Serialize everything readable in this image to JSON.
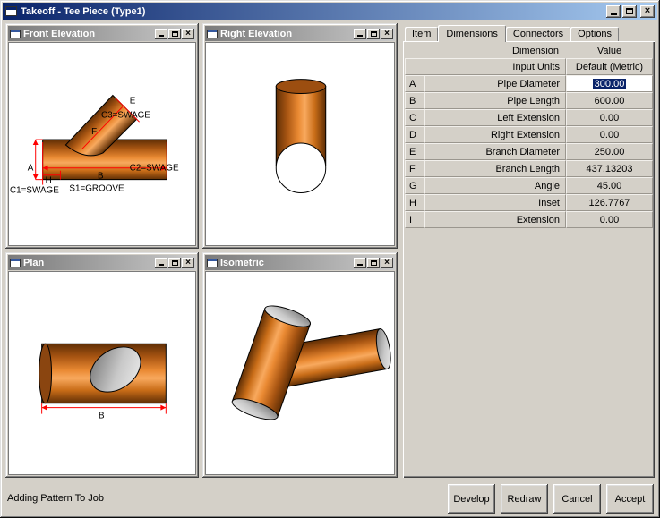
{
  "window": {
    "title": "Takeoff - Tee Piece (Type1)"
  },
  "icons": {
    "close": "×"
  },
  "viewports": {
    "front": {
      "title": "Front Elevation",
      "labels": {
        "e": "E",
        "c3": "C3=SWAGE",
        "f": "F",
        "a": "A",
        "h": "H",
        "b": "B",
        "c2": "C2=SWAGE",
        "c1": "C1=SWAGE",
        "s1": "S1=GROOVE"
      }
    },
    "right": {
      "title": "Right Elevation"
    },
    "plan": {
      "title": "Plan",
      "labels": {
        "b": "B"
      }
    },
    "iso": {
      "title": "Isometric"
    }
  },
  "panel": {
    "tabs": [
      {
        "label": "Item"
      },
      {
        "label": "Dimensions"
      },
      {
        "label": "Connectors"
      },
      {
        "label": "Options"
      }
    ],
    "active_tab": "Dimensions",
    "table": {
      "col_dimension": "Dimension",
      "col_value": "Value",
      "input_units": {
        "label": "Input Units",
        "value": "Default (Metric)"
      },
      "rows": [
        {
          "key": "A",
          "label": "Pipe Diameter",
          "value": "300.00"
        },
        {
          "key": "B",
          "label": "Pipe Length",
          "value": "600.00"
        },
        {
          "key": "C",
          "label": "Left Extension",
          "value": "0.00"
        },
        {
          "key": "D",
          "label": "Right Extension",
          "value": "0.00"
        },
        {
          "key": "E",
          "label": "Branch Diameter",
          "value": "250.00"
        },
        {
          "key": "F",
          "label": "Branch Length",
          "value": "437.13203"
        },
        {
          "key": "G",
          "label": "Angle",
          "value": "45.00"
        },
        {
          "key": "H",
          "label": "Inset",
          "value": "126.7767"
        },
        {
          "key": "I",
          "label": "Extension",
          "value": "0.00"
        }
      ],
      "selected_row": "A"
    }
  },
  "footer": {
    "status": "Adding Pattern To Job",
    "buttons": [
      {
        "label": "Develop"
      },
      {
        "label": "Redraw"
      },
      {
        "label": "Cancel"
      },
      {
        "label": "Accept"
      }
    ]
  },
  "colors": {
    "titlebar_gradient_start": "#0a246a",
    "titlebar_gradient_end": "#a6caf0",
    "chrome": "#d4d0c8",
    "copper_dark": "#5f2e05",
    "copper_mid": "#ea8a33",
    "copper_light": "#f8a95e",
    "dimension_line": "#ff0000",
    "selection": "#0a246a"
  }
}
